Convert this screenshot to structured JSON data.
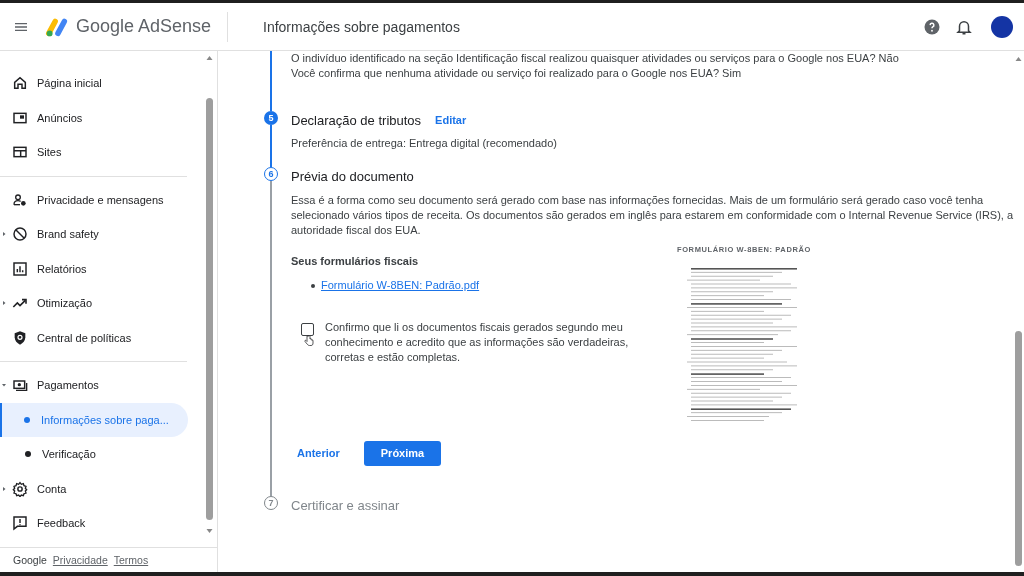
{
  "header": {
    "app_name": "Google AdSense",
    "page_title": "Informações sobre pagamentos"
  },
  "sidebar": {
    "sections": [
      {
        "items": [
          {
            "label": "Página inicial",
            "kind": "link",
            "selected": false
          },
          {
            "label": "Anúncios",
            "kind": "link",
            "selected": false
          },
          {
            "label": "Sites",
            "kind": "link",
            "selected": false
          }
        ]
      },
      {
        "items": [
          {
            "label": "Privacidade e mensagens",
            "kind": "link",
            "selected": false
          },
          {
            "label": "Brand safety",
            "kind": "group",
            "expanded": false,
            "selected": false
          },
          {
            "label": "Relatórios",
            "kind": "link",
            "selected": false
          },
          {
            "label": "Otimização",
            "kind": "group",
            "expanded": false,
            "selected": false
          },
          {
            "label": "Central de políticas",
            "kind": "link",
            "selected": false
          }
        ]
      },
      {
        "items": [
          {
            "label": "Pagamentos",
            "kind": "group",
            "expanded": true,
            "selected": false,
            "children": [
              {
                "label": "Informações sobre paga...",
                "selected": true
              },
              {
                "label": "Verificação",
                "selected": false
              }
            ]
          },
          {
            "label": "Conta",
            "kind": "group",
            "expanded": false,
            "selected": false
          },
          {
            "label": "Feedback",
            "kind": "link",
            "selected": false
          }
        ]
      }
    ],
    "footer": {
      "brand": "Google",
      "links": [
        "Privacidade",
        "Termos"
      ]
    }
  },
  "content": {
    "intro_lines": [
      "O indivíduo identificado na seção Identificação fiscal realizou quaisquer atividades ou serviços para o Google nos EUA? Não",
      "Você confirma que nenhuma atividade ou serviço foi realizado para o Google nos EUA? Sim"
    ],
    "steps": [
      {
        "number": "5",
        "title": "Declaração de tributos",
        "completed": true,
        "active": false,
        "action": "Editar",
        "body": "Preferência de entrega: Entrega digital (recomendado)"
      },
      {
        "number": "6",
        "title": "Prévia do documento",
        "completed": false,
        "active": true,
        "body": "Essa é a forma como seu documento será gerado com base nas informações fornecidas. Mais de um formulário será gerado caso você tenha selecionado vários tipos de receita. Os documentos são gerados em inglês para estarem em conformidade com o Internal Revenue Service (IRS), a autoridade fiscal dos EUA.",
        "forms_heading": "Seus formulários fiscais",
        "files": [
          "Formulário W-8BEN: Padrão.pdf"
        ],
        "confirm": {
          "label": "Confirmo que li os documentos fiscais gerados segundo meu conhecimento e acredito que as informações são verdadeiras, corretas e estão completas.",
          "checked": false
        },
        "preview_title": "FORMULÁRIO W-8BEN: PADRÃO",
        "buttons": [
          {
            "label": "Anterior",
            "kind": "text"
          },
          {
            "label": "Próxima",
            "kind": "filled"
          }
        ]
      },
      {
        "number": "7",
        "title": "Certificar e assinar",
        "completed": false,
        "active": false
      }
    ]
  }
}
